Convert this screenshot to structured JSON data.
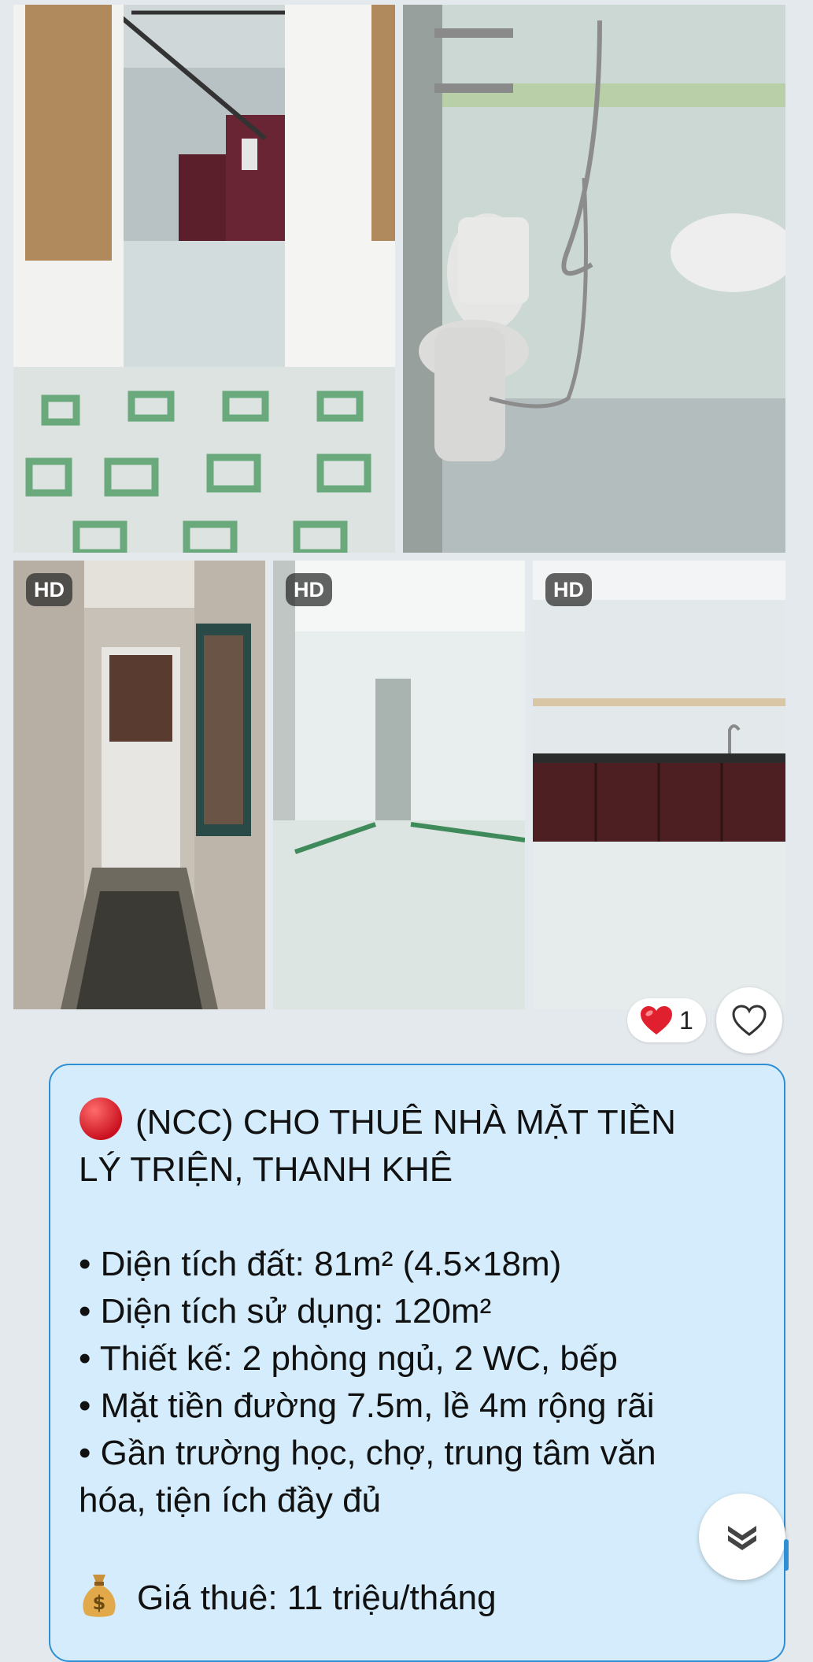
{
  "gallery": {
    "photos": [
      {
        "name": "photo-entrance-stairs"
      },
      {
        "name": "photo-bathroom"
      },
      {
        "name": "photo-hallway-door",
        "badge": "HD"
      },
      {
        "name": "photo-empty-room",
        "badge": "HD"
      },
      {
        "name": "photo-kitchen",
        "badge": "HD"
      }
    ]
  },
  "reactions": {
    "emoji": "heart-icon",
    "count": "1",
    "like_icon": "heart-outline-icon"
  },
  "message": {
    "title_line1": "(NCC) CHO THUÊ NHÀ MẶT TIỀN",
    "title_line2": "LÝ TRIỆN, THANH KHÊ",
    "bullets": [
      "• Diện tích đất: 81m² (4.5×18m)",
      "• Diện tích sử dụng: 120m²",
      "• Thiết kế: 2 phòng ngủ, 2 WC, bếp",
      "• Mặt tiền đường 7.5m, lề 4m rộng rãi",
      "• Gần trường học, chợ, trung tâm văn"
    ],
    "bullet_continuation": "hóa, tiện ích đầy đủ",
    "price": "Giá thuê: 11 triệu/tháng"
  },
  "colors": {
    "background": "#e4e9ee",
    "bubble": "#d4ecfb",
    "bubble_border": "#2f8fd3",
    "heart": "#e0202e"
  },
  "icons": {
    "title_marker": "red-circle-icon",
    "price_marker": "money-bag-icon",
    "scroll_down": "chevrons-down-icon"
  }
}
